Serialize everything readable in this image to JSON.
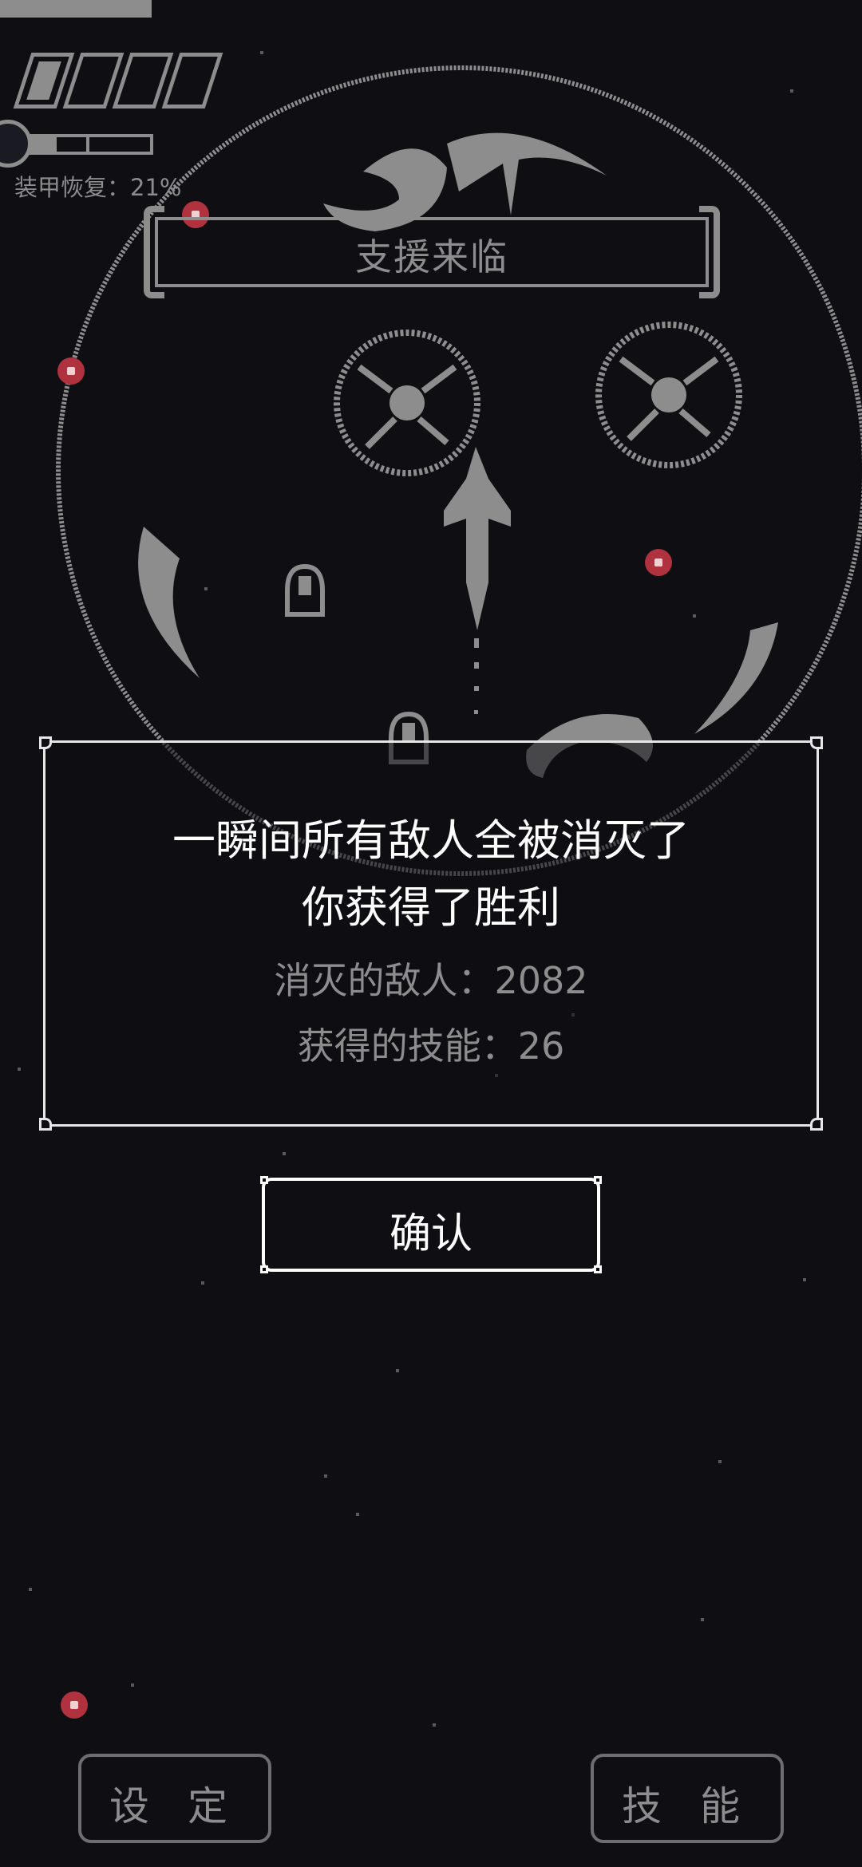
{
  "hud": {
    "armor_recovery_text": "装甲恢复：21%",
    "armor_recovery_percent": 21,
    "armor_segments_total": 4,
    "armor_segments_filled": 1
  },
  "banner": {
    "text": "支援来临"
  },
  "dialog": {
    "line1": "一瞬间所有敌人全被消灭了",
    "line2": "你获得了胜利",
    "enemies_destroyed": "消灭的敌人：2082",
    "skills_obtained": "获得的技能：26"
  },
  "confirm_button": {
    "label": "确认"
  },
  "bottom": {
    "settings_label": "设 定",
    "skills_label": "技 能"
  },
  "colors": {
    "background": "#0e0e13",
    "ui_gray": "#8d8d8d",
    "white": "#ffffff",
    "enemy_red": "#b0323e"
  }
}
